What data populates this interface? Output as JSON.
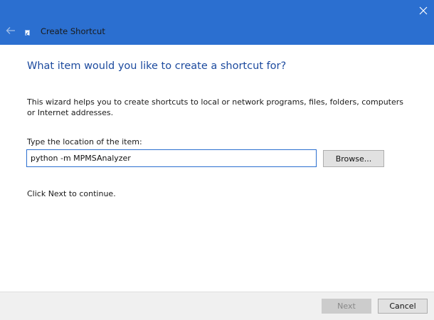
{
  "window": {
    "title": "Create Shortcut",
    "close_icon": "close-icon",
    "back_icon": "back-arrow-icon",
    "app_icon": "shortcut-icon"
  },
  "wizard": {
    "heading": "What item would you like to create a shortcut for?",
    "intro": "This wizard helps you to create shortcuts to local or network programs, files, folders, computers or Internet addresses.",
    "location_label": "Type the location of the item:",
    "location_value": "python -m MPMSAnalyzer",
    "browse_label": "Browse...",
    "continue_text": "Click Next to continue."
  },
  "footer": {
    "next_label": "Next",
    "next_enabled": false,
    "cancel_label": "Cancel"
  },
  "colors": {
    "titlebar": "#2b6fd0",
    "heading": "#1c4a9e",
    "input_border": "#2b6fd0"
  }
}
